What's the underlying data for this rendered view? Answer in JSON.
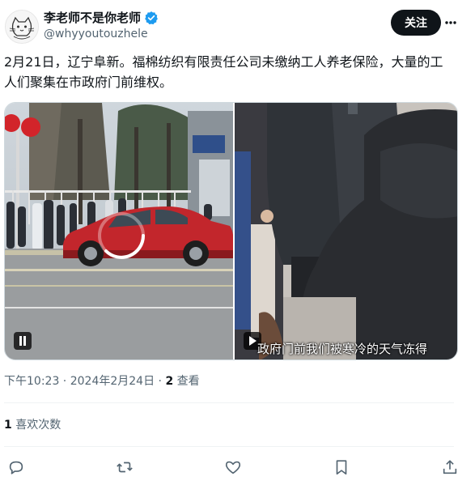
{
  "author": {
    "display_name": "李老师不是你老师",
    "handle": "@whyyoutouzhele",
    "verified": true
  },
  "follow_label": "关注",
  "tweet": {
    "text": "2月21日，辽宁阜新。福棉纺织有限责任公司未缴纳工人养老保险，大量的工人们聚集在市政府门前维权。"
  },
  "media": {
    "video_1": {
      "state": "playing"
    },
    "video_2": {
      "state": "paused",
      "subtitle": "政府门前我们被寒冷的天气冻得"
    }
  },
  "meta": {
    "time": "下午10:23",
    "separator": " · ",
    "date": "2024年2月24日",
    "views_count": "2",
    "views_label": " 查看"
  },
  "stats": {
    "likes_count": "1",
    "likes_label": " 喜欢次数"
  },
  "icons": {
    "verified": "verified-badge-icon",
    "more": "more-icon",
    "reply": "reply-icon",
    "retweet": "retweet-icon",
    "like": "heart-icon",
    "bookmark": "bookmark-icon",
    "share": "share-icon"
  },
  "colors": {
    "verified_blue": "#1d9bf0",
    "text_primary": "#0f1419",
    "text_secondary": "#536471",
    "follow_bg": "#0f1419"
  }
}
